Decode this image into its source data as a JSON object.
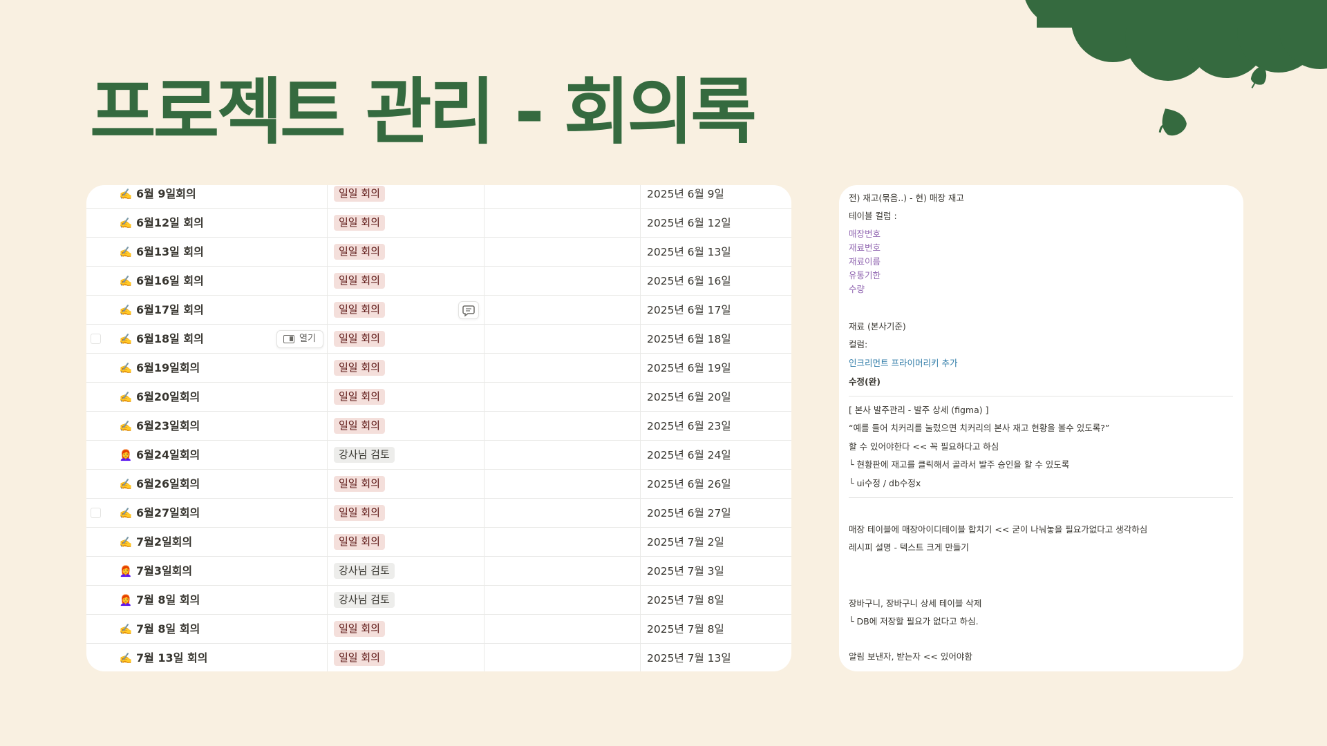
{
  "title": "프로젝트 관리 - 회의록",
  "colors": {
    "background": "#f9f0e1",
    "brand_green": "#356a3f",
    "tag_daily_bg": "#f4dfdb",
    "tag_review_bg": "#ededeb",
    "note_purple": "#9065b0",
    "note_blue": "#337ea9"
  },
  "table": {
    "open_label": "열기",
    "rows": [
      {
        "icon": "✍️",
        "icon_name": "writing-hand-icon",
        "name": "6월 9일회의",
        "tag": "일일 회의",
        "tag_type": "daily",
        "date": "2025년 6월 9일"
      },
      {
        "icon": "✍️",
        "icon_name": "writing-hand-icon",
        "name": "6월12일 회의",
        "tag": "일일 회의",
        "tag_type": "daily",
        "date": "2025년 6월 12일"
      },
      {
        "icon": "✍️",
        "icon_name": "writing-hand-icon",
        "name": "6월13일 회의",
        "tag": "일일 회의",
        "tag_type": "daily",
        "date": "2025년 6월 13일"
      },
      {
        "icon": "✍️",
        "icon_name": "writing-hand-icon",
        "name": "6월16일 회의",
        "tag": "일일 회의",
        "tag_type": "daily",
        "date": "2025년 6월 16일"
      },
      {
        "icon": "✍️",
        "icon_name": "writing-hand-icon",
        "name": "6월17일 회의",
        "tag": "일일 회의",
        "tag_type": "daily",
        "date": "2025년 6월 17일",
        "comment": true
      },
      {
        "icon": "✍️",
        "icon_name": "writing-hand-icon",
        "name": "6월18일 회의",
        "tag": "일일 회의",
        "tag_type": "daily",
        "date": "2025년 6월 18일",
        "hovered": true
      },
      {
        "icon": "✍️",
        "icon_name": "writing-hand-icon",
        "name": "6월19일회의",
        "tag": "일일 회의",
        "tag_type": "daily",
        "date": "2025년 6월 19일"
      },
      {
        "icon": "✍️",
        "icon_name": "writing-hand-icon",
        "name": "6월20일회의",
        "tag": "일일 회의",
        "tag_type": "daily",
        "date": "2025년 6월 20일"
      },
      {
        "icon": "✍️",
        "icon_name": "writing-hand-icon",
        "name": "6월23일회의",
        "tag": "일일 회의",
        "tag_type": "daily",
        "date": "2025년 6월 23일"
      },
      {
        "icon": "👩‍🦰",
        "icon_name": "person-icon",
        "name": "6월24일회의",
        "tag": "강사님 검토",
        "tag_type": "review",
        "date": "2025년 6월 24일"
      },
      {
        "icon": "✍️",
        "icon_name": "writing-hand-icon",
        "name": "6월26일회의",
        "tag": "일일 회의",
        "tag_type": "daily",
        "date": "2025년 6월 26일"
      },
      {
        "icon": "✍️",
        "icon_name": "writing-hand-icon",
        "name": "6월27일회의",
        "tag": "일일 회의",
        "tag_type": "daily",
        "date": "2025년 6월 27일",
        "checkbox": true
      },
      {
        "icon": "✍️",
        "icon_name": "writing-hand-icon",
        "name": "7월2일회의",
        "tag": "일일 회의",
        "tag_type": "daily",
        "date": "2025년 7월 2일"
      },
      {
        "icon": "👩‍🦰",
        "icon_name": "person-icon",
        "name": "7월3일회의",
        "tag": "강사님 검토",
        "tag_type": "review",
        "date": "2025년 7월 3일"
      },
      {
        "icon": "👩‍🦰",
        "icon_name": "person-icon",
        "name": "7월 8일 회의",
        "tag": "강사님 검토",
        "tag_type": "review",
        "date": "2025년 7월 8일"
      },
      {
        "icon": "✍️",
        "icon_name": "writing-hand-icon",
        "name": "7월 8일 회의",
        "tag": "일일 회의",
        "tag_type": "daily",
        "date": "2025년 7월 8일"
      },
      {
        "icon": "✍️",
        "icon_name": "writing-hand-icon",
        "name": "7월 13일 회의",
        "tag": "일일 회의",
        "tag_type": "daily",
        "date": "2025년 7월 13일"
      }
    ]
  },
  "notes": {
    "lines": [
      {
        "text": "전) 재고(묶음..) - 현) 매장 재고",
        "style": ""
      },
      {
        "text": "테이블 컬럼 :",
        "style": ""
      },
      {
        "text": "매장번호",
        "style": "purple"
      },
      {
        "text": "재료번호",
        "style": "purple"
      },
      {
        "text": "재료이름",
        "style": "purple"
      },
      {
        "text": "유통기한",
        "style": "purple"
      },
      {
        "text": "수량",
        "style": "purple"
      },
      {
        "text": "재료 (본사기준)",
        "style": ""
      },
      {
        "text": "컬럼:",
        "style": ""
      },
      {
        "text": "인크리먼트 프라이머리키 추가",
        "style": "blue"
      },
      {
        "text": "수정(완)",
        "style": "bold"
      },
      {
        "text": "[ 본사 발주관리 - 발주 상세  (figma) ]",
        "style": ""
      },
      {
        "text": "“예를 들어 치커리를 눌렀으면 치커리의 본사 재고 현황을 볼수 있도록?”",
        "style": ""
      },
      {
        "text": "할 수 있어야한다 << 꼭 필요하다고 하심",
        "style": ""
      },
      {
        "text": "└ 현황판에 재고를 클릭해서 골라서 발주 승인을 할 수 있도록",
        "style": ""
      },
      {
        "text": "└  ui수정 / db수정x",
        "style": ""
      },
      {
        "text": "매장 테이블에 매장아이디테이블 합치기 << 굳이 나눠놓을 필요가없다고 생각하심",
        "style": ""
      },
      {
        "text": "레시피 설명 - 텍스트 크게 만들기",
        "style": ""
      },
      {
        "text": "장바구니, 장바구니 상세 테이블 삭제",
        "style": ""
      },
      {
        "text": "└ DB에 저장할 필요가 없다고 하심.",
        "style": ""
      },
      {
        "text": "알림 보낸자, 받는자 << 있어야함",
        "style": ""
      }
    ]
  }
}
